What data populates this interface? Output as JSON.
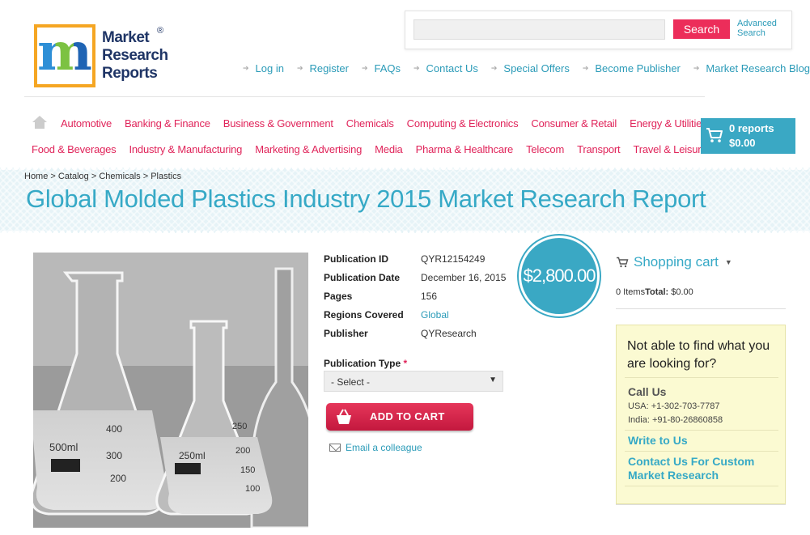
{
  "logo": {
    "line1": "Market",
    "line2": "Research",
    "line3": "Reports",
    "reg": "®"
  },
  "search": {
    "placeholder": "",
    "button": "Search",
    "advanced": "Advanced Search"
  },
  "top_links": [
    "Log in",
    "Register",
    "FAQs",
    "Contact Us",
    "Special Offers",
    "Become Publisher",
    "Market Research Blog"
  ],
  "categories_row1": [
    "Automotive",
    "Banking & Finance",
    "Business & Government",
    "Chemicals",
    "Computing & Electronics",
    "Consumer & Retail",
    "Energy & Utilities"
  ],
  "categories_row2": [
    "Food & Beverages",
    "Industry & Manufacturing",
    "Marketing & Advertising",
    "Media",
    "Pharma & Healthcare",
    "Telecom",
    "Transport",
    "Travel & Leisure"
  ],
  "header_cart": {
    "reports": "0 reports",
    "total": "$0.00"
  },
  "breadcrumb": "Home > Catalog > Chemicals > Plastics",
  "title": "Global Molded Plastics Industry 2015 Market Research Report",
  "details": {
    "pub_id_label": "Publication ID",
    "pub_id": "QYR12154249",
    "pub_date_label": "Publication Date",
    "pub_date": "December 16, 2015",
    "pages_label": "Pages",
    "pages": "156",
    "regions_label": "Regions Covered",
    "regions": "Global",
    "publisher_label": "Publisher",
    "publisher": "QYResearch"
  },
  "price": "$2,800.00",
  "pub_type": {
    "label": "Publication Type",
    "required": "*",
    "selected": "- Select -"
  },
  "add_to_cart": "ADD TO CART",
  "email_colleague": "Email a colleague",
  "shopping_cart": {
    "title": "Shopping cart",
    "items": "0 Items",
    "total_label": "Total:",
    "total": "$0.00"
  },
  "help": {
    "question": "Not able to find what you are looking for?",
    "call_title": "Call Us",
    "usa": "USA: +1-302-703-7787",
    "india": "India: +91-80-26860858",
    "write": "Write to Us",
    "custom": "Contact Us For Custom Market Research"
  },
  "image": {
    "labels": [
      "500ml",
      "400",
      "300",
      "200",
      "250ml",
      "250",
      "200",
      "150",
      "100"
    ]
  },
  "colors": {
    "accent": "#36a9c6",
    "pink": "#e0245a",
    "button": "#ec2d5a"
  }
}
